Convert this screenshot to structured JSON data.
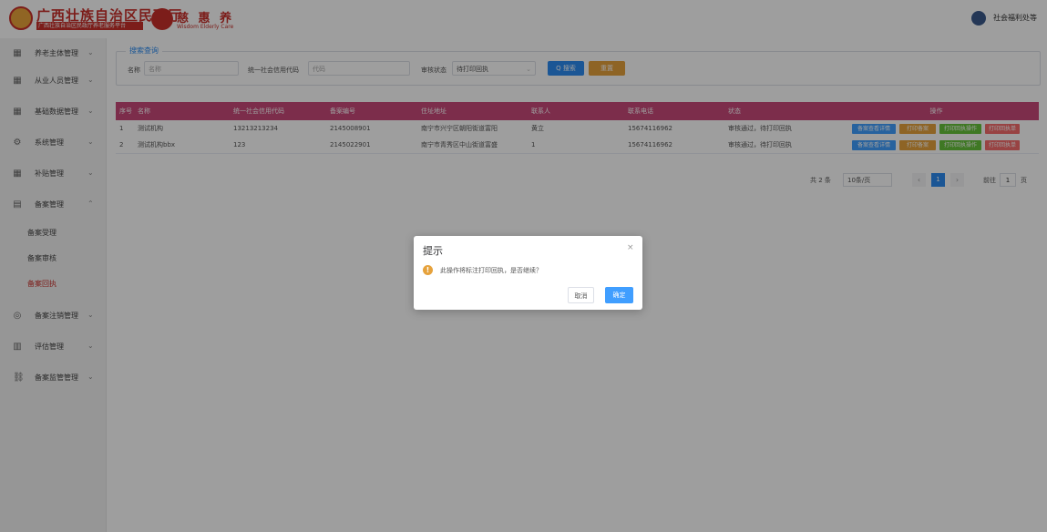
{
  "header": {
    "title": "广西壮族自治区民政厅",
    "subtitle": "广西壮族自治区民政厅养老服务平台",
    "brand2": "慈 惠 养",
    "brand2_sub": "Wisdom Elderly Care",
    "user_name": "社会福利处等"
  },
  "sidebar": {
    "items": [
      {
        "label": "养老主体管理",
        "icon": "grid-icon"
      },
      {
        "label": "从业人员管理",
        "icon": "grid-icon"
      },
      {
        "label": "基础数据管理",
        "icon": "grid-icon"
      },
      {
        "label": "系统管理",
        "icon": "gear-icon"
      },
      {
        "label": "补贴管理",
        "icon": "grid-icon"
      },
      {
        "label": "备案管理",
        "icon": "doc-icon"
      },
      {
        "label": "备案注销管理",
        "icon": "circle-icon"
      },
      {
        "label": "评估管理",
        "icon": "chart-icon"
      },
      {
        "label": "备案监管管理",
        "icon": "link-icon"
      }
    ],
    "subitems": [
      {
        "label": "备案受理"
      },
      {
        "label": "备案审核"
      },
      {
        "label": "备案回执"
      }
    ]
  },
  "search": {
    "legend": "搜索查询",
    "name_label": "名称",
    "name_placeholder": "名称",
    "code_label": "统一社会信用代码",
    "code_placeholder": "代码",
    "status_label": "审核状态",
    "status_value": "待打印回执",
    "search_btn": "Q 搜索",
    "reset_btn": "重置"
  },
  "table": {
    "headers": [
      "序号",
      "名称",
      "统一社会信用代码",
      "备案编号",
      "住址地址",
      "联系人",
      "联系电话",
      "状态",
      "操作"
    ],
    "rows": [
      {
        "no": "1",
        "name": "测试机构",
        "code": "13213213234",
        "record": "2145008901",
        "address": "南宁市兴宁区朝阳街道富阳",
        "contact": "黄立",
        "phone": "15674116962",
        "status": "审核通过，待打印回执"
      },
      {
        "no": "2",
        "name": "测试机构bbx",
        "code": "123",
        "record": "2145022901",
        "address": "南宁市青秀区中山街道富盛",
        "contact": "1",
        "phone": "15674116962",
        "status": "审核通过，待打印回执"
      }
    ],
    "ops": [
      {
        "label": "备案查看详情",
        "color": "#409eff"
      },
      {
        "label": "打印备案",
        "color": "#e6a23c"
      },
      {
        "label": "打印回执操作",
        "color": "#67c23a"
      },
      {
        "label": "打印回执单",
        "color": "#f56c6c"
      }
    ]
  },
  "pager": {
    "total": "共 2 条",
    "page_size": "10条/页",
    "prev": "‹",
    "current": "1",
    "next": "›",
    "goto_label": "前往",
    "goto_value": "1",
    "goto_suffix": "页"
  },
  "dialog": {
    "title": "提示",
    "close": "×",
    "message": "此操作将标注打印回执，是否继续？",
    "cancel": "取消",
    "ok": "确定"
  }
}
